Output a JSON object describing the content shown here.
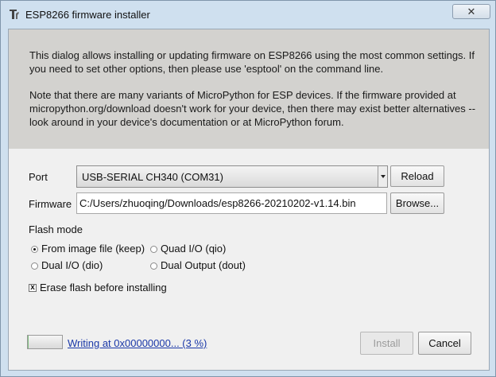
{
  "window": {
    "title": "ESP8266 firmware installer",
    "app_icon": "wrench-tool-icon",
    "close_icon": "close-icon",
    "close_glyph": "✕"
  },
  "info": {
    "paragraph_1": "This dialog allows installing or updating firmware on ESP8266 using the most common settings. If you need to set other options, then please use 'esptool' on the command line.",
    "paragraph_2": "Note that there are many variants of MicroPython for ESP devices. If the firmware provided at micropython.org/download doesn't work for your device, then there may exist better alternatives -- look around in your device's documentation or at MicroPython forum."
  },
  "port": {
    "label": "Port",
    "selected": "USB-SERIAL CH340 (COM31)",
    "reload_label": "Reload"
  },
  "firmware": {
    "label": "Firmware",
    "value": "C:/Users/zhuoqing/Downloads/esp8266-20210202-v1.14.bin",
    "browse_label": "Browse..."
  },
  "flash_mode": {
    "label": "Flash mode",
    "options": [
      {
        "label": "From image file (keep)",
        "selected": true
      },
      {
        "label": "Quad I/O (qio)",
        "selected": false
      },
      {
        "label": "Dual I/O (dio)",
        "selected": false
      },
      {
        "label": "Dual Output (dout)",
        "selected": false
      }
    ]
  },
  "erase": {
    "label": "Erase flash before installing",
    "checked": true,
    "check_glyph": "x"
  },
  "footer": {
    "progress_fraction": 0.03,
    "status_text": "Writing at 0x00000000... (3 %)",
    "install_label": "Install",
    "install_enabled": false,
    "cancel_label": "Cancel"
  }
}
